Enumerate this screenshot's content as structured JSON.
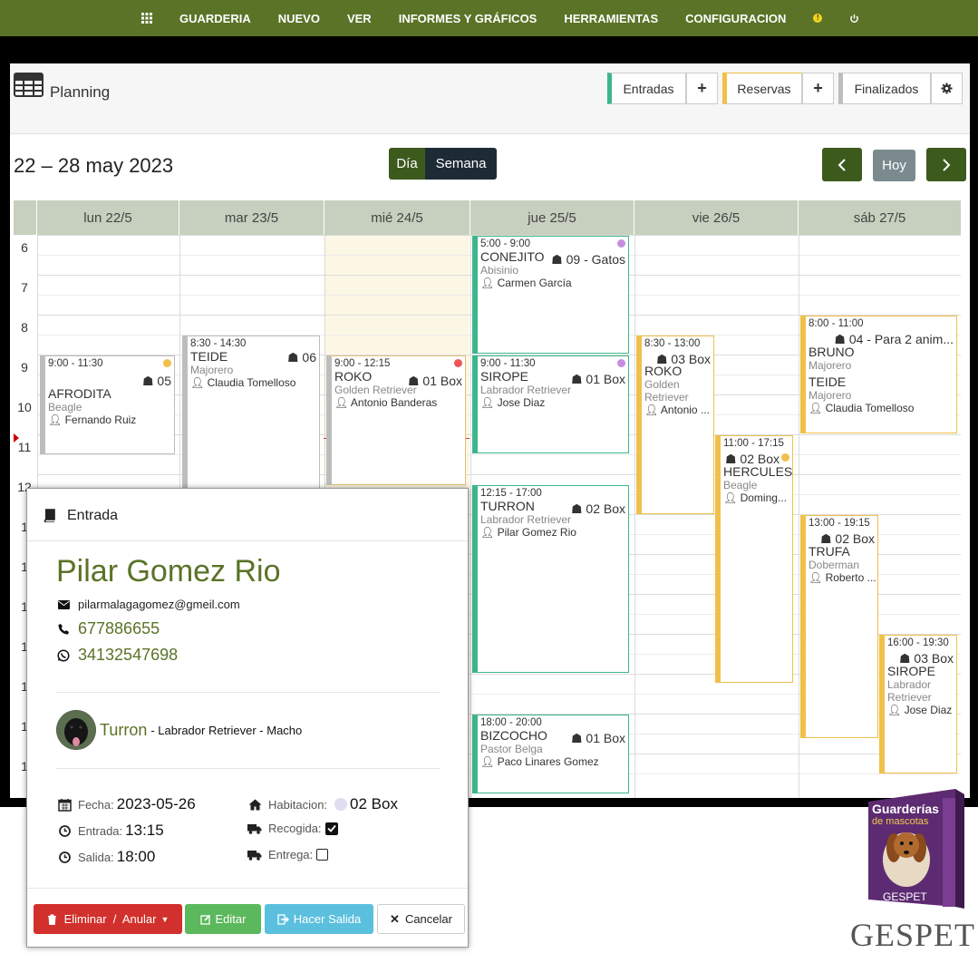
{
  "nav": {
    "items": [
      "GUARDERIA",
      "NUEVO",
      "VER",
      "INFORMES Y GRÁFICOS",
      "HERRAMIENTAS",
      "CONFIGURACION"
    ],
    "warning_icon": "warning-icon",
    "power_icon": "power-icon",
    "color": "#5a7327"
  },
  "header": {
    "title": "Planning",
    "entradas": "Entradas",
    "reservas": "Reservas",
    "finalizados": "Finalizados",
    "plus": "+"
  },
  "toolbar": {
    "date_range": "22 – 28 may 2023",
    "view_day": "Día",
    "view_week": "Semana",
    "today": "Hoy"
  },
  "days": [
    "lun 22/5",
    "mar 23/5",
    "mié 24/5",
    "jue 25/5",
    "vie 26/5",
    "sáb 27/5"
  ],
  "hours": [
    "6",
    "7",
    "8",
    "9",
    "10",
    "11",
    "12",
    "1",
    "1",
    "1",
    "1",
    "1",
    "1",
    "1"
  ],
  "events": [
    {
      "time": "9:00 - 11:30",
      "box": "05",
      "name": "AFRODITA",
      "breed": "Beagle",
      "owner": "Fernando Ruiz"
    },
    {
      "time": "8:30 - 14:30",
      "box": "06",
      "name": "TEIDE",
      "breed": "Majorero",
      "owner": "Claudia Tomelloso"
    },
    {
      "time": "9:00 - 12:15",
      "box": "01 Box",
      "name": "ROKO",
      "breed": "Golden Retriever",
      "owner": "Antonio Banderas"
    },
    {
      "time": "5:00 - 9:00",
      "box": "09 - Gatos",
      "name": "CONEJITO",
      "breed": "Abisinio",
      "owner": "Carmen García"
    },
    {
      "time": "9:00 - 11:30",
      "box": "01 Box",
      "name": "SIROPE",
      "breed": "Labrador Retriever",
      "owner": "Jose Diaz"
    },
    {
      "time": "12:15 - 17:00",
      "box": "02 Box",
      "name": "TURRON",
      "breed": "Labrador Retriever",
      "owner": "Pilar Gomez Rio"
    },
    {
      "time": "18:00 - 20:00",
      "box": "01 Box",
      "name": "BIZCOCHO",
      "breed": "Pastor Belga",
      "owner": "Paco Linares Gomez"
    },
    {
      "time": "8:30 - 13:00",
      "box": "03 Box",
      "name": "ROKO",
      "breed1": "Golden",
      "breed2": "Retriever",
      "owner": "Antonio ..."
    },
    {
      "time": "11:00 - 17:15",
      "box": "02 Box",
      "name": "HERCULES",
      "breed": "Beagle",
      "owner": "Doming..."
    },
    {
      "time": "8:00 - 11:00",
      "box": "04 - Para 2 anim...",
      "name": "BRUNO",
      "breed": "Majorero",
      "name2": "TEIDE",
      "breed2": "Majorero",
      "owner": "Claudia Tomelloso"
    },
    {
      "time": "13:00 - 19:15",
      "box": "02 Box",
      "name": "TRUFA",
      "breed": "Doberman",
      "owner": "Roberto ..."
    },
    {
      "time": "16:00 - 19:30",
      "box": "03 Box",
      "name": "SIROPE",
      "breed1": "Labrador",
      "breed2": "Retriever",
      "owner": "Jose Diaz"
    }
  ],
  "modal": {
    "title": "Entrada",
    "client_name": "Pilar Gomez Rio",
    "email": "pilarmalagagomez@gmeil.com",
    "phone": "677886655",
    "whatsapp": "34132547698",
    "pet_name": "Turron",
    "pet_desc": "- Labrador Retriever - Macho",
    "fecha_label": "Fecha:",
    "fecha": "2023-05-26",
    "entrada_label": "Entrada:",
    "entrada": "13:15",
    "salida_label": "Salida:",
    "salida": "18:00",
    "habitacion_label": "Habitacion:",
    "habitacion": "02 Box",
    "recogida_label": "Recogida:",
    "recogida_checked": true,
    "entrega_label": "Entrega:",
    "entrega_checked": false,
    "btn_eliminar": "Eliminar  /  Anular",
    "btn_editar": "Editar",
    "btn_salida": "Hacer Salida",
    "btn_cancelar": "Cancelar"
  },
  "logo": {
    "box_title": "Guarderías",
    "box_sub": "de mascotas",
    "box_brand": "GESPET",
    "wordmark": "GESPET"
  },
  "colors": {
    "green_entry": "#3cb68a",
    "yellow_reserve": "#f0c04a",
    "gray_final": "#bdbdbd",
    "dark_green": "#3d5a1d",
    "btn_red": "#d2302c",
    "btn_green": "#5cb85c",
    "btn_blue": "#5bc0de"
  }
}
